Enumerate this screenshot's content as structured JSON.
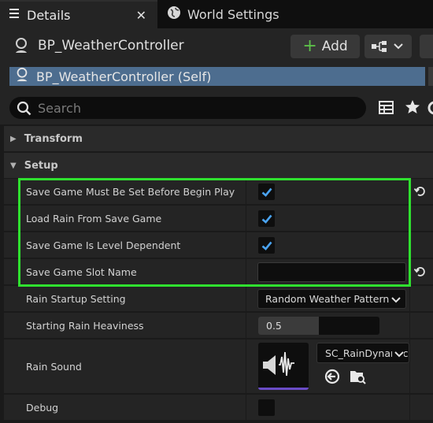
{
  "tabs": [
    {
      "label": "Details",
      "icon": "details-icon",
      "active": true
    },
    {
      "label": "World Settings",
      "icon": "globe-icon",
      "active": false
    }
  ],
  "header": {
    "title": "BP_WeatherController",
    "add_label": "Add"
  },
  "component_tree": {
    "self_label": "BP_WeatherController (Self)"
  },
  "search": {
    "placeholder": "Search",
    "value": ""
  },
  "categories": {
    "transform": "Transform",
    "setup": "Setup"
  },
  "properties": {
    "save_must_set": {
      "label": "Save Game Must Be Set Before Begin Play",
      "checked": true
    },
    "load_rain": {
      "label": "Load Rain From Save Game",
      "checked": true
    },
    "level_dependent": {
      "label": "Save Game Is Level Dependent",
      "checked": true
    },
    "slot_name": {
      "label": "Save Game Slot Name",
      "value": ""
    },
    "rain_startup": {
      "label": "Rain Startup Setting",
      "value": "Random Weather Patterns"
    },
    "rain_heaviness": {
      "label": "Starting Rain Heaviness",
      "value": "0.5",
      "fraction": 0.5
    },
    "rain_sound": {
      "label": "Rain Sound",
      "value": "SC_RainDynamic"
    },
    "debug": {
      "label": "Debug",
      "checked": false
    }
  },
  "colors": {
    "highlight": "#2fe12f",
    "checkbox": "#4aa3f0",
    "add_plus": "#5cc049",
    "selection": "#4d6d8f"
  }
}
